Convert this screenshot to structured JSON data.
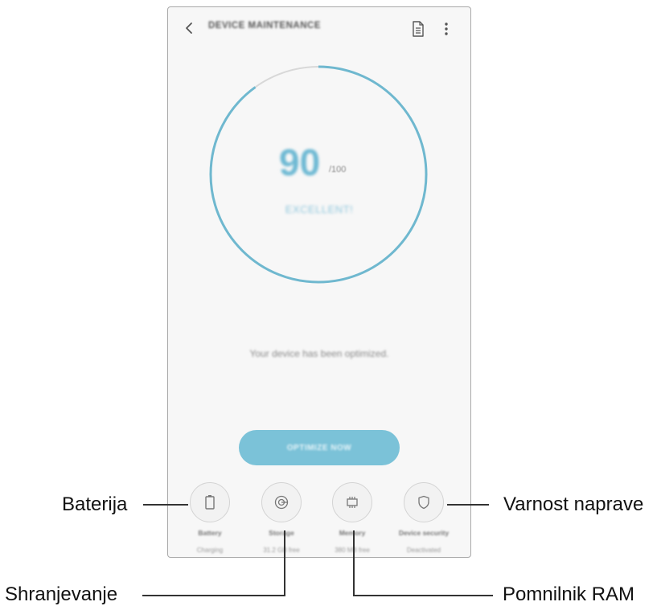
{
  "header": {
    "title": "DEVICE MAINTENANCE",
    "back_icon": "chevron-left-icon",
    "report_icon": "document-icon",
    "more_icon": "more-vertical-icon"
  },
  "score": {
    "value": "90",
    "max": "/100",
    "status": "EXCELLENT!",
    "gauge_fraction": 0.9,
    "colors": {
      "progress": "#6fb8cf",
      "track": "#d8d8d8",
      "accent": "#7bc2d8"
    }
  },
  "message": "Your device has been optimized.",
  "optimize_button": {
    "label": "OPTIMIZE NOW"
  },
  "tiles": [
    {
      "label": "Battery",
      "value": "Charging",
      "icon": "battery-icon"
    },
    {
      "label": "Storage",
      "value": "31.2 GB free",
      "icon": "storage-icon"
    },
    {
      "label": "Memory",
      "value": "380 MB free",
      "icon": "memory-chip-icon"
    },
    {
      "label": "Device security",
      "value": "Deactivated",
      "icon": "shield-icon"
    }
  ],
  "callouts": {
    "battery": "Baterija",
    "storage": "Shranjevanje",
    "memory": "Pomnilnik RAM",
    "security": "Varnost naprave"
  }
}
